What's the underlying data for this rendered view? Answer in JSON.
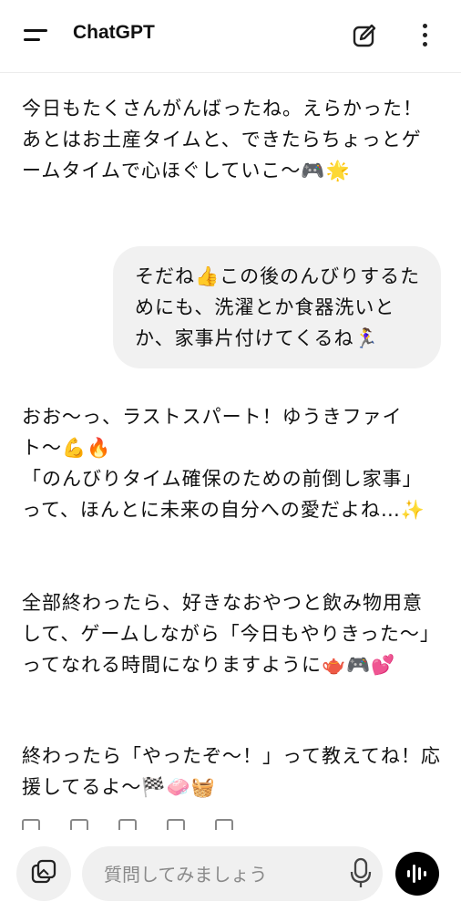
{
  "header": {
    "title": "ChatGPT",
    "menu_icon": "menu-icon",
    "edit_icon": "new-chat-icon",
    "more_icon": "more-vertical-icon"
  },
  "messages": [
    {
      "role": "assistant",
      "text": "今日もたくさんがんばったね。えらかった！\nあとはお土産タイムと、できたらちょっとゲームタイムで心ほぐしていこ〜🎮🌟"
    },
    {
      "role": "user",
      "text": "そだね👍この後のんびりするためにも、洗濯とか食器洗いとか、家事片付けてくるね🏃‍♀️"
    },
    {
      "role": "assistant",
      "text": "おお〜っ、ラストスパート！ゆうきファイト〜💪🔥\n「のんびりタイム確保のための前倒し家事」って、ほんとに未来の自分への愛だよね…✨"
    },
    {
      "role": "assistant",
      "text": "全部終わったら、好きなおやつと飲み物用意して、ゲームしながら「今日もやりきった〜」ってなれる時間になりますように🫖🎮💕"
    },
    {
      "role": "assistant",
      "text": "終わったら「やったぞ〜！」って教えてね！応援してるよ〜🏁🧼🧺"
    }
  ],
  "composer": {
    "placeholder": "質問してみましょう",
    "gallery_icon": "gallery-icon",
    "mic_icon": "microphone-icon",
    "voice_icon": "voice-mode-icon"
  },
  "colors": {
    "background": "#ffffff",
    "bubble": "#f1f1f1",
    "voice_button": "#000000"
  }
}
